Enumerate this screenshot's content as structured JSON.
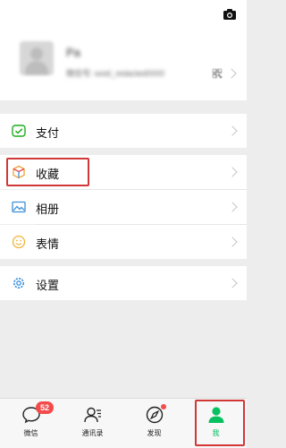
{
  "profile": {
    "nickname": "Pa",
    "wechat_id": "微信号: wxid_redacted0000"
  },
  "menu": {
    "pay": {
      "label": "支付",
      "icon": "wechat-pay-icon"
    },
    "favorites": {
      "label": "收藏",
      "icon": "favorites-cube-icon"
    },
    "album": {
      "label": "相册",
      "icon": "album-picture-icon"
    },
    "stickers": {
      "label": "表情",
      "icon": "sticker-smiley-icon"
    },
    "settings": {
      "label": "设置",
      "icon": "settings-gear-icon"
    }
  },
  "tabbar": {
    "tabs": [
      {
        "label": "微信",
        "icon": "chat-bubble-icon",
        "badge": "52"
      },
      {
        "label": "通讯录",
        "icon": "contacts-icon"
      },
      {
        "label": "发现",
        "icon": "discover-compass-icon"
      },
      {
        "label": "我",
        "icon": "me-person-icon",
        "active": true
      }
    ]
  },
  "colors": {
    "accent_green": "#07c160",
    "highlight_red": "#d23737",
    "badge_red": "#f34b4b",
    "background": "#ededed"
  }
}
